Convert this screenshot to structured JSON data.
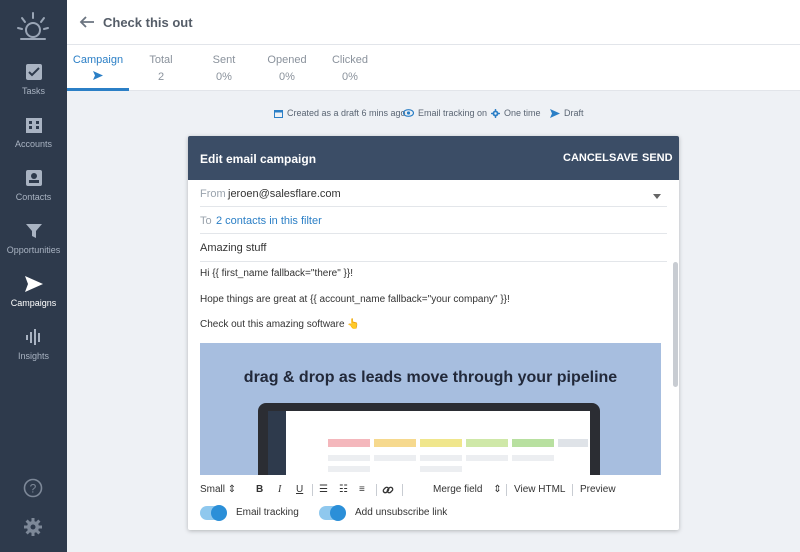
{
  "sidebar": {
    "items": [
      {
        "label": "Tasks",
        "icon": "tasks-check-icon"
      },
      {
        "label": "Accounts",
        "icon": "building-icon"
      },
      {
        "label": "Contacts",
        "icon": "contact-card-icon"
      },
      {
        "label": "Opportunities",
        "icon": "funnel-icon"
      },
      {
        "label": "Campaigns",
        "icon": "paper-plane-icon"
      },
      {
        "label": "Insights",
        "icon": "bars-icon"
      }
    ],
    "active": "Campaigns"
  },
  "header": {
    "title": "Check this out"
  },
  "stats": [
    {
      "label": "Campaign",
      "value": ""
    },
    {
      "label": "Total",
      "value": "2"
    },
    {
      "label": "Sent",
      "value": "0%"
    },
    {
      "label": "Opened",
      "value": "0%"
    },
    {
      "label": "Clicked",
      "value": "0%"
    }
  ],
  "meta": {
    "created": "Created as a draft 6 mins ago",
    "tracking": "Email tracking on",
    "frequency": "One time",
    "status": "Draft"
  },
  "editor": {
    "title": "Edit email campaign",
    "cancel": "CANCEL",
    "save": "SAVE",
    "send": "SEND",
    "from_label": "From",
    "from_value": "jeroen@salesflare.com",
    "to_label": "To",
    "to_value": "2 contacts in this filter",
    "subject": "Amazing stuff",
    "body": [
      "Hi {{ first_name fallback=\"there\" }}!",
      "Hope things are great at {{ account_name fallback=\"your company\" }}!",
      "Check out this amazing software 👆"
    ],
    "image_headline": "drag & drop as leads move through your pipeline"
  },
  "toolbar": {
    "size": "Small",
    "merge_field": "Merge field",
    "view_html": "View HTML",
    "preview": "Preview"
  },
  "toggles": {
    "tracking": "Email tracking",
    "unsubscribe": "Add unsubscribe link"
  },
  "colors": {
    "sidebar": "#2e3a4c",
    "accent": "#2b7fc6",
    "card_header": "#3b4d66"
  }
}
